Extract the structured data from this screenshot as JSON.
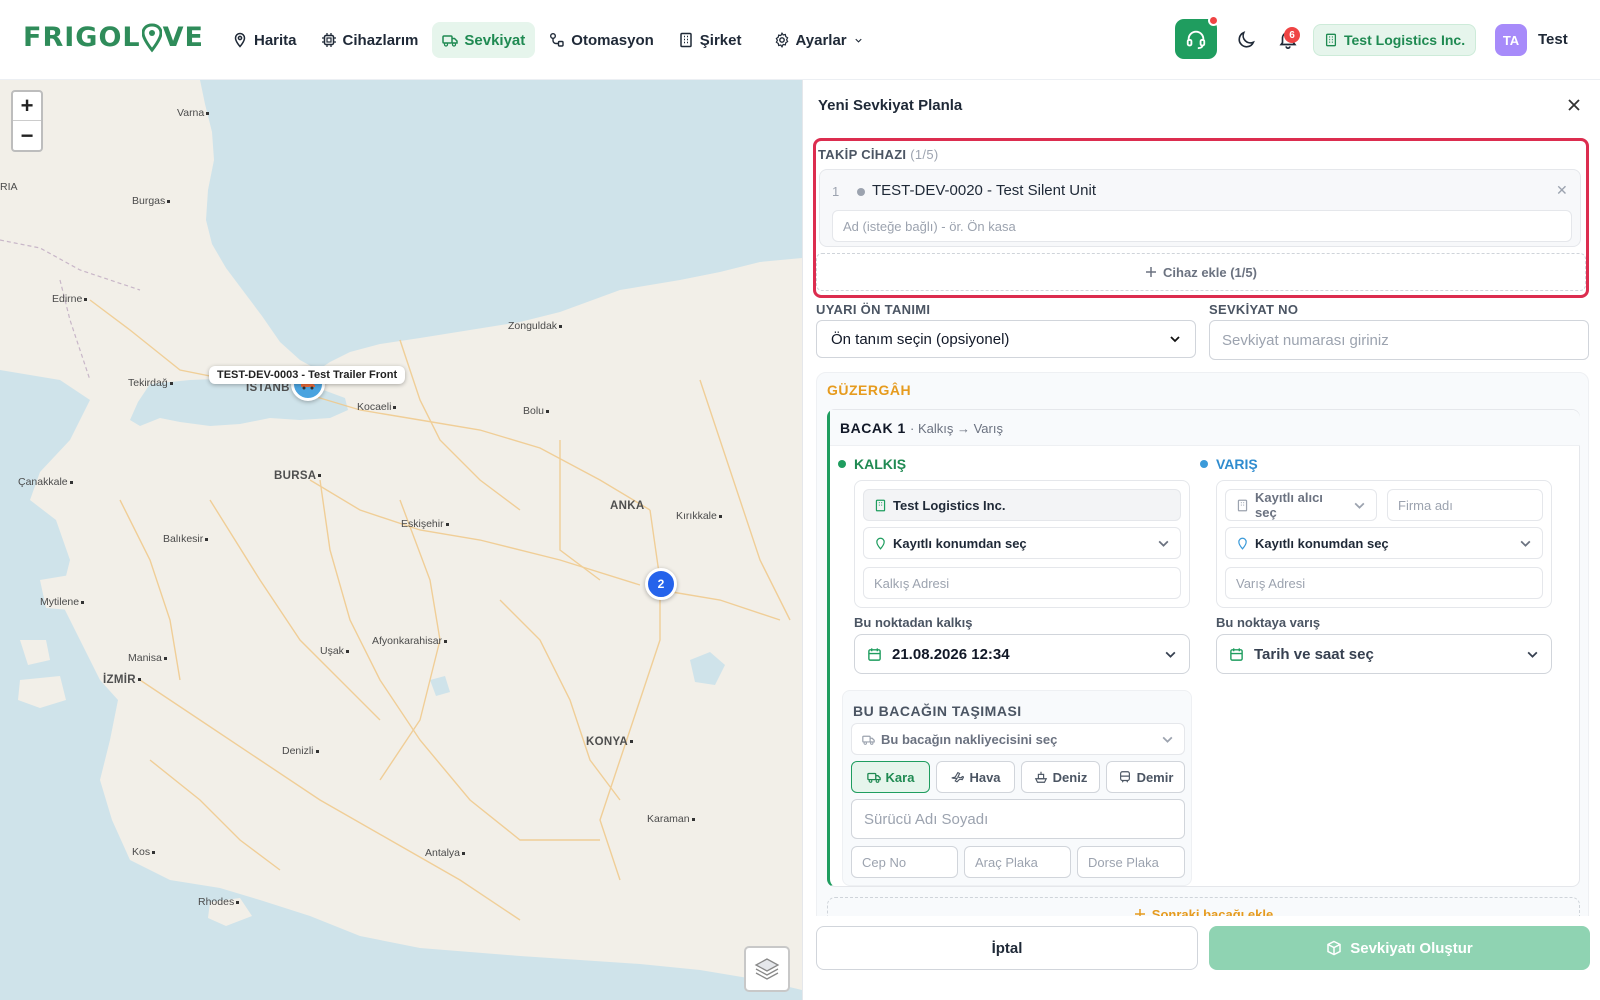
{
  "brand": {
    "logo_text_1": "FRIGOL",
    "logo_text_2": "VE",
    "accent": "#1f9d5f"
  },
  "nav": [
    {
      "label": "Harita",
      "icon": "map-pin-icon",
      "active": false
    },
    {
      "label": "Cihazlarım",
      "icon": "chip-icon",
      "active": false
    },
    {
      "label": "Sevkiyat",
      "icon": "truck-icon",
      "active": true
    },
    {
      "label": "Otomasyon",
      "icon": "workflow-icon",
      "active": false
    },
    {
      "label": "Şirket",
      "icon": "building-icon",
      "active": false
    },
    {
      "label": "Ayarlar",
      "icon": "gear-icon",
      "active": false
    }
  ],
  "header": {
    "notifications_count": "6",
    "company": "Test Logistics Inc.",
    "avatar_initials": "TA",
    "user_name": "Test"
  },
  "map": {
    "zoom_in": "+",
    "zoom_out": "−",
    "marker_label": "TEST-DEV-0003 - Test Trailer Front",
    "cluster_count": "2",
    "cities": [
      {
        "name": "Varna",
        "big": false
      },
      {
        "name": "RIA",
        "big": false
      },
      {
        "name": "Burgas",
        "big": false
      },
      {
        "name": "Edirne",
        "big": false
      },
      {
        "name": "Zonguldak",
        "big": false
      },
      {
        "name": "Tekirdağ",
        "big": false
      },
      {
        "name": "İSTANB",
        "big": true
      },
      {
        "name": "Kocaeli",
        "big": false
      },
      {
        "name": "Bolu",
        "big": false
      },
      {
        "name": "Çanakkale",
        "big": false
      },
      {
        "name": "BURSA",
        "big": true
      },
      {
        "name": "ANKA",
        "big": true
      },
      {
        "name": "Kırıkkale",
        "big": false
      },
      {
        "name": "Eskişehir",
        "big": false
      },
      {
        "name": "Balıkesir",
        "big": false
      },
      {
        "name": "Mytilene",
        "big": false
      },
      {
        "name": "Afyonkarahisar",
        "big": false
      },
      {
        "name": "Manisa",
        "big": false
      },
      {
        "name": "Uşak",
        "big": false
      },
      {
        "name": "İZMİR",
        "big": true
      },
      {
        "name": "Denizli",
        "big": false
      },
      {
        "name": "KONYA",
        "big": true
      },
      {
        "name": "Karaman",
        "big": false
      },
      {
        "name": "Kos",
        "big": false
      },
      {
        "name": "Antalya",
        "big": false
      },
      {
        "name": "Rhodes",
        "big": false
      }
    ]
  },
  "panel": {
    "title": "Yeni Sevkiyat Planla",
    "tracking": {
      "label": "TAKİP CİHAZI",
      "count": "(1/5)",
      "device_index": "1",
      "device_name": "TEST-DEV-0020 - Test Silent Unit",
      "name_placeholder": "Ad (isteğe bağlı) - ör. Ön kasa",
      "add_label": "Cihaz ekle (1/5)"
    },
    "alert_preset": {
      "label": "UYARI ÖN TANIMI",
      "value": "Ön tanım seçin (opsiyonel)"
    },
    "shipment_no": {
      "label": "SEVKİYAT NO",
      "placeholder": "Sevkiyat numarası giriniz"
    },
    "route": {
      "title": "GÜZERGÂH",
      "leg_title": "BACAK 1",
      "leg_sub": "· Kalkış → Varış",
      "departure": {
        "label": "KALKIŞ",
        "company": "Test Logistics Inc.",
        "location": "Kayıtlı konumdan seç",
        "address_placeholder": "Kalkış Adresi",
        "time_label": "Bu noktadan kalkış",
        "time_value": "21.08.2026 12:34"
      },
      "arrival": {
        "label": "VARIŞ",
        "receiver": "Kayıtlı alıcı seç",
        "firm_placeholder": "Firma adı",
        "location": "Kayıtlı konumdan seç",
        "address_placeholder": "Varış Adresi",
        "time_label": "Bu noktaya varış",
        "time_value": "Tarih ve saat seç"
      },
      "transport": {
        "title": "BU BACAĞIN TAŞIMASI",
        "carrier": "Bu bacağın nakliyecisini seç",
        "modes": [
          "Kara",
          "Hava",
          "Deniz",
          "Demir"
        ],
        "driver_placeholder": "Sürücü Adı Soyadı",
        "phone_placeholder": "Cep No",
        "plate_placeholder": "Araç Plaka",
        "trailer_placeholder": "Dorse Plaka"
      },
      "next_leg": "Sonraki bacağı ekle"
    },
    "cancel": "İptal",
    "create": "Sevkiyatı Oluştur"
  }
}
